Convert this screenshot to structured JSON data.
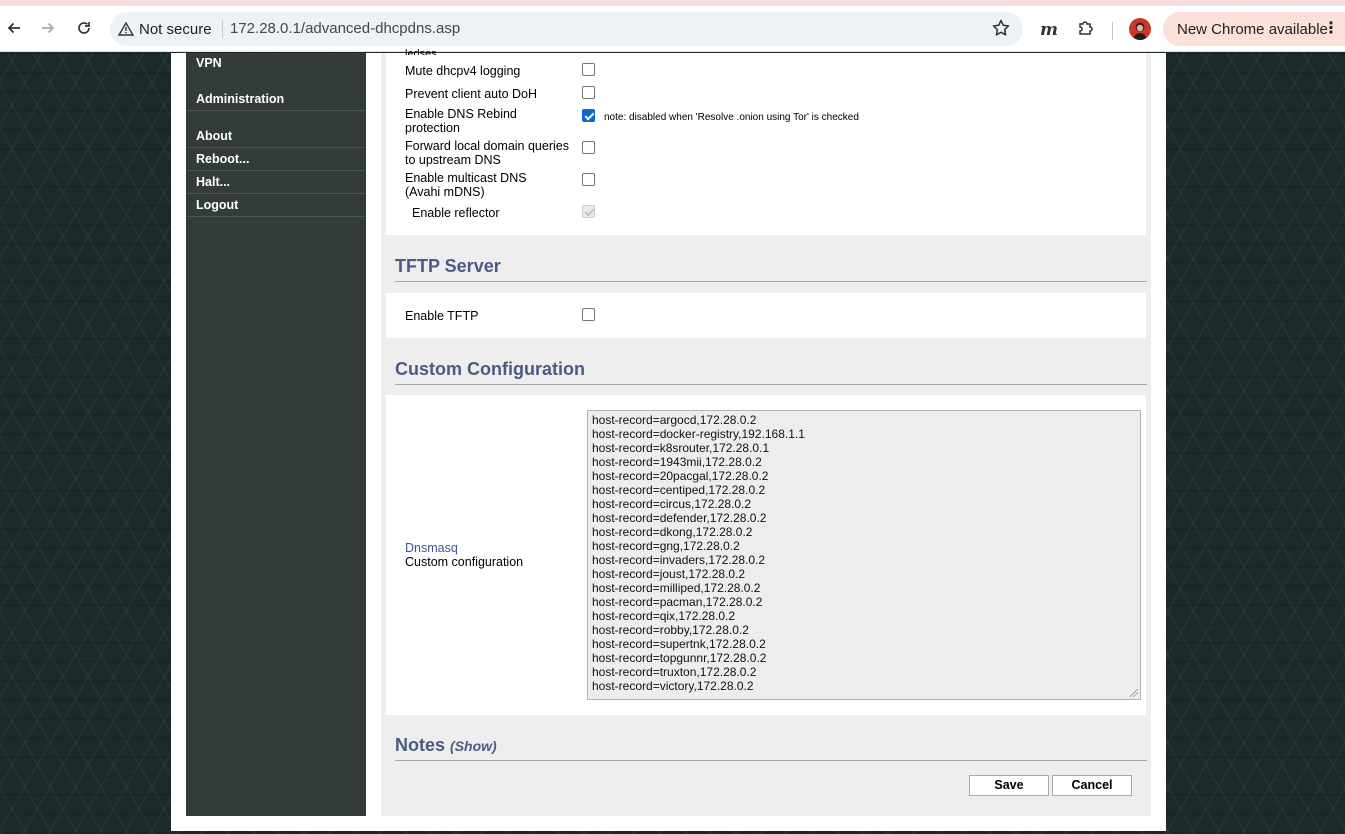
{
  "browser": {
    "security_label": "Not secure",
    "url": "172.28.0.1/advanced-dhcpdns.asp",
    "extension_label": "m",
    "update_label": "New Chrome available"
  },
  "sidebar": {
    "items": [
      {
        "label": "VPN"
      },
      {
        "label": "Administration"
      },
      {
        "label": "About"
      },
      {
        "label": "Reboot..."
      },
      {
        "label": "Halt..."
      },
      {
        "label": "Logout"
      }
    ]
  },
  "dns_options": {
    "clipped_label": "ledses",
    "rows": [
      {
        "label_1": "Mute dhcpv4 logging",
        "label_2": "",
        "checked": false
      },
      {
        "label_1": "Prevent client auto DoH",
        "label_2": "",
        "checked": false
      },
      {
        "label_1": "Enable DNS Rebind",
        "label_2": "protection",
        "checked": true
      },
      {
        "label_1": "Forward local domain queries",
        "label_2": "to upstream DNS",
        "checked": false
      },
      {
        "label_1": "Enable multicast DNS",
        "label_2": "(Avahi mDNS)",
        "checked": false
      },
      {
        "label_1": "Enable reflector",
        "label_2": "",
        "checked": true,
        "disabled": true
      }
    ],
    "rebind_note": "note: disabled when 'Resolve .onion using Tor' is checked"
  },
  "tftp": {
    "title": "TFTP Server",
    "enable_label": "Enable TFTP",
    "checked": false
  },
  "custom_config": {
    "title": "Custom Configuration",
    "link_label": "Dnsmasq",
    "label": "Custom configuration",
    "lines": [
      "host-record=argocd,172.28.0.2",
      "host-record=docker-registry,192.168.1.1",
      "host-record=k8srouter,172.28.0.1",
      "host-record=1943mii,172.28.0.2",
      "host-record=20pacgal,172.28.0.2",
      "host-record=centiped,172.28.0.2",
      "host-record=circus,172.28.0.2",
      "host-record=defender,172.28.0.2",
      "host-record=dkong,172.28.0.2",
      "host-record=gng,172.28.0.2",
      "host-record=invaders,172.28.0.2",
      "host-record=joust,172.28.0.2",
      "host-record=milliped,172.28.0.2",
      "host-record=pacman,172.28.0.2",
      "host-record=qix,172.28.0.2",
      "host-record=robby,172.28.0.2",
      "host-record=supertnk,172.28.0.2",
      "host-record=topgunnr,172.28.0.2",
      "host-record=truxton,172.28.0.2",
      "host-record=victory,172.28.0.2"
    ]
  },
  "notes": {
    "title": "Notes",
    "show_label": "(Show)"
  },
  "actions": {
    "save_label": "Save",
    "cancel_label": "Cancel"
  },
  "colors": {
    "section_title": "#4a5a82",
    "sidebar_bg": "#333b3b",
    "checkbox_checked": "#0b66d6",
    "update_chip": "#fbe1d9"
  }
}
